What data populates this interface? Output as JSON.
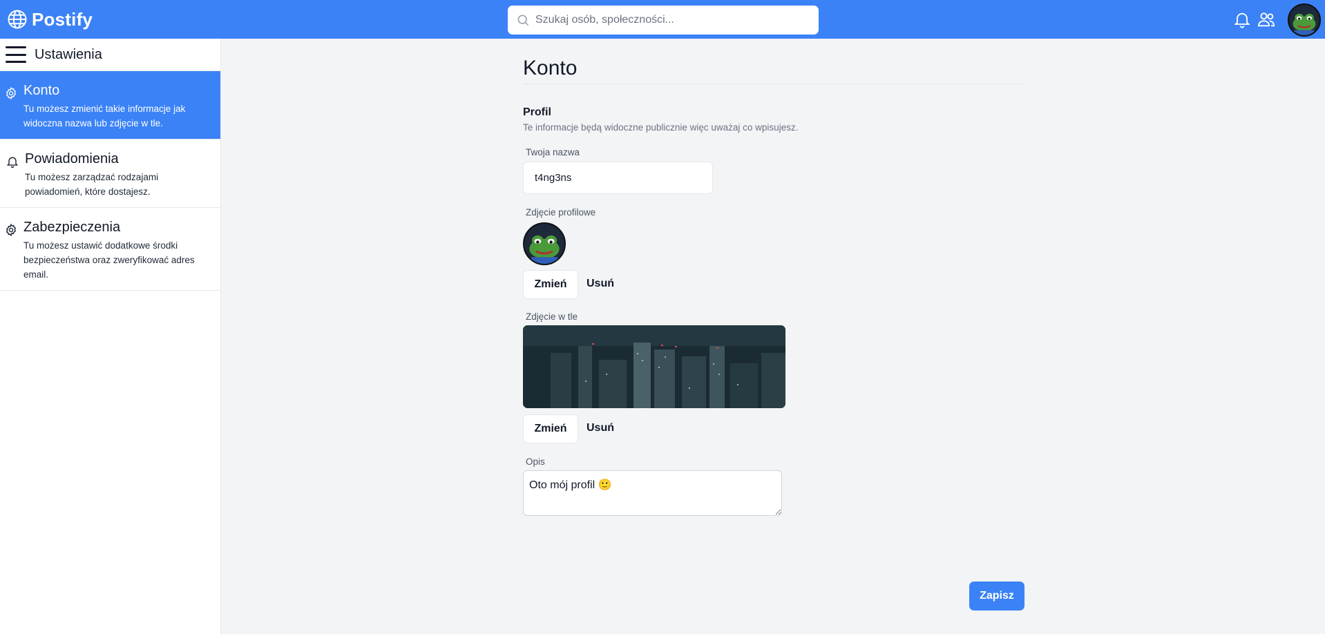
{
  "app": {
    "name": "Postify"
  },
  "search": {
    "placeholder": "Szukaj osób, społeczności..."
  },
  "colors": {
    "primary": "#3b82f6",
    "background": "#f3f4f6"
  },
  "sidebar": {
    "title": "Ustawienia",
    "items": [
      {
        "icon": "gear-icon",
        "title": "Konto",
        "desc": "Tu możesz zmienić takie informacje jak widoczna nazwa lub zdjęcie w tle.",
        "active": true
      },
      {
        "icon": "bell-icon",
        "title": "Powiadomienia",
        "desc": "Tu możesz zarządzać rodzajami powiadomień, które dostajesz.",
        "active": false
      },
      {
        "icon": "gear-icon",
        "title": "Zabezpieczenia",
        "desc": "Tu możesz ustawić dodatkowe środki bezpieczeństwa oraz zweryfikować adres email.",
        "active": false
      }
    ]
  },
  "main": {
    "title": "Konto",
    "section": {
      "title": "Profil",
      "desc": "Te informacje będą widoczne publicznie więc uważaj co wpisujesz."
    },
    "name_label": "Twoja nazwa",
    "name_value": "t4ng3ns",
    "profile_pic_label": "Zdjęcie profilowe",
    "banner_label": "Zdjęcie w tle",
    "change_label": "Zmień",
    "remove_label": "Usuń",
    "desc_label": "Opis",
    "desc_value": "Oto mój profil 🙂",
    "save_label": "Zapisz"
  }
}
